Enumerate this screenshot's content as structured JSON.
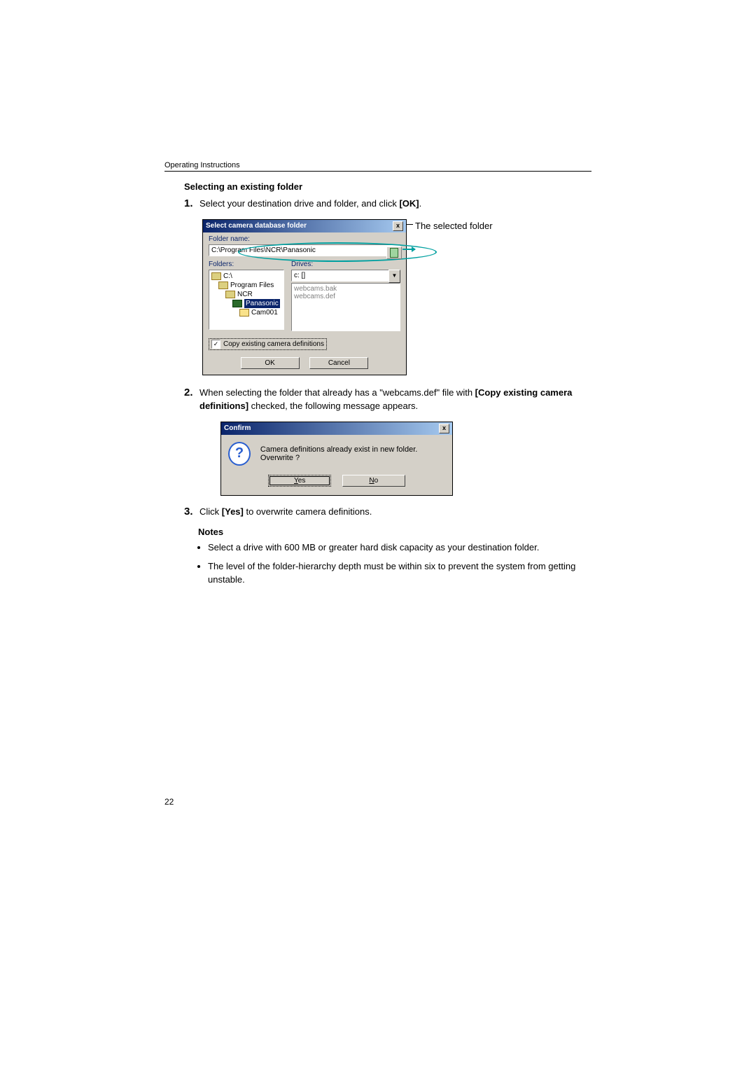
{
  "header": {
    "running_head": "Operating Instructions"
  },
  "section": {
    "title": "Selecting an existing folder"
  },
  "steps": {
    "s1": {
      "num": "1.",
      "text_pre": "Select your destination drive and folder, and click ",
      "bold": "[OK]",
      "text_post": "."
    },
    "s2": {
      "num": "2.",
      "text_pre": "When selecting the folder that already has a \"webcams.def\" file with ",
      "bold": "[Copy existing camera definitions]",
      "text_post": " checked, the following message appears."
    },
    "s3": {
      "num": "3.",
      "text_pre": "Click ",
      "bold": "[Yes]",
      "text_post": " to overwrite camera definitions."
    }
  },
  "callout": {
    "selected_folder": "The selected folder"
  },
  "dialog1": {
    "title": "Select camera database folder",
    "close_x": "x",
    "folder_name_label": "Folder name:",
    "folder_name_value": "C:\\Program Files\\NCR\\Panasonic",
    "folders_label": "Folders:",
    "drives_label": "Drives:",
    "drive_value": "c: []",
    "drive_arrow": "▼",
    "tree": {
      "t0": "C:\\",
      "t1": "Program Files",
      "t2": "NCR",
      "t3": "Panasonic",
      "t4": "Cam001"
    },
    "right_list": {
      "r0": "webcams.bak",
      "r1": "webcams.def"
    },
    "copy_checkbox_label": "Copy existing camera definitions",
    "check_mark": "✓",
    "ok": "OK",
    "cancel": "Cancel"
  },
  "dialog2": {
    "title": "Confirm",
    "close_x": "x",
    "qmark": "?",
    "message": "Camera definitions already exist in new folder. Overwrite ?",
    "yes": "Yes",
    "no": "No"
  },
  "notes": {
    "heading": "Notes",
    "n1": "Select a drive with 600 MB or greater hard disk capacity as your destination folder.",
    "n2": "The level of the folder-hierarchy depth must be within six to prevent the system from getting unstable."
  },
  "page_number": "22"
}
